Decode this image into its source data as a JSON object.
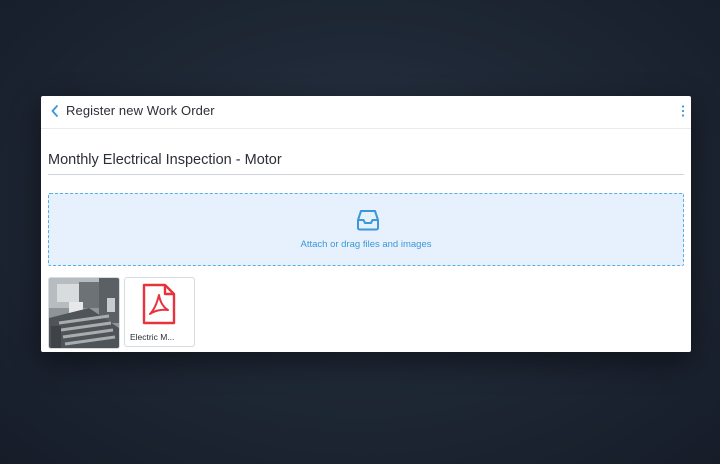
{
  "header": {
    "title": "Register new Work Order",
    "back_icon": "chevron-left-icon",
    "menu_icon": "more-vertical-icon"
  },
  "work_order": {
    "title_value": "Monthly Electrical Inspection - Motor"
  },
  "dropzone": {
    "label": "Attach or drag files and images",
    "icon": "inbox-icon"
  },
  "attachments": [
    {
      "type": "image",
      "icon": "photo-thumbnail"
    },
    {
      "type": "pdf",
      "name": "Electric M...",
      "icon": "pdf-icon"
    }
  ],
  "colors": {
    "accent": "#3a97d8",
    "dropzone_bg": "#e7f1fd",
    "pdf_red": "#e8333c"
  }
}
